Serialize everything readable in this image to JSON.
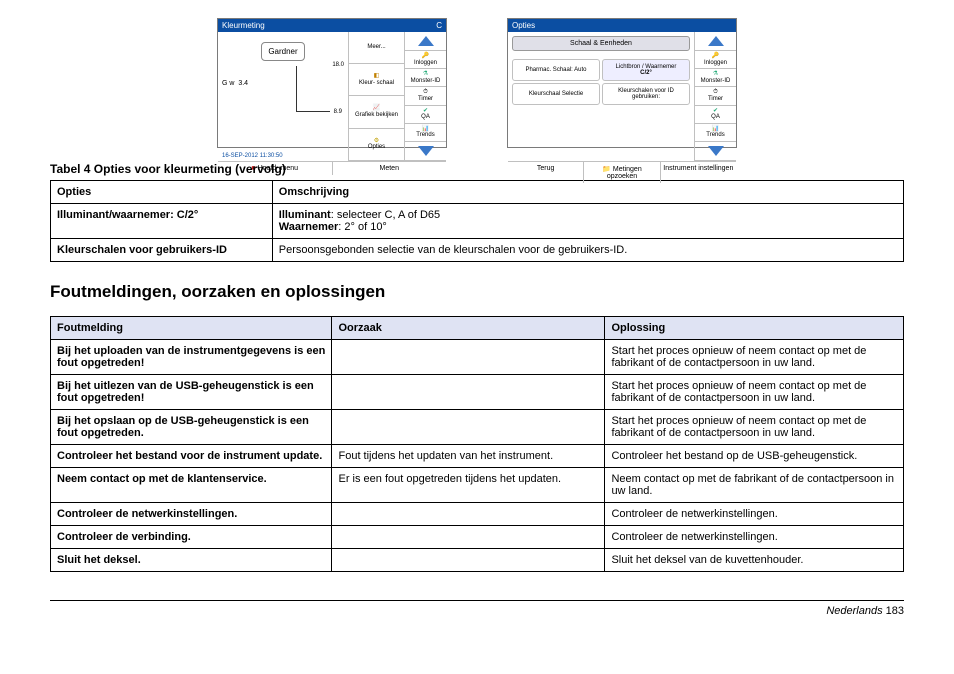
{
  "fig1": {
    "title": "Kleurmeting",
    "menu_more": "Meer...",
    "gardner": "Gardner",
    "gw_label": "G w",
    "gw_value": "3.4",
    "tick_top": "18.0",
    "tick_mid": "8.9",
    "timestamp": "16-SEP-2012  11:30:50",
    "foot_left": "Hoofd-\nmenu",
    "foot_right": "Meten",
    "mid": {
      "b1": "Kleur-\nschaal",
      "b2": "Grafiek\nbekijken",
      "b3": "Opties"
    },
    "side": {
      "s1": "Inloggen",
      "s2": "Monster-ID",
      "s3": "Timer",
      "s4": "QA",
      "s5": "Trends"
    }
  },
  "fig2": {
    "title": "Opties",
    "header": "Schaal & Eenheden",
    "hl_right_t": "Lichtbron / Waarnemer",
    "hl_right_v": "C/2°",
    "c1": "Pharmac. Schaal:\nAuto",
    "c2": "Kleurschalen voor\nID gebruiken:",
    "c3": "Kleurschaal\nSelectie",
    "foot_1": "Terug",
    "foot_2": "Metingen\nopzoeken",
    "foot_3": "Instrument\ninstellingen",
    "side": {
      "s1": "Inloggen",
      "s2": "Monster-ID",
      "s3": "Timer",
      "s4": "QA",
      "s5": "Trends"
    }
  },
  "table4": {
    "caption": "Tabel 4  Opties voor kleurmeting (vervolg)",
    "h1": "Opties",
    "h2": "Omschrijving",
    "r1c1": "Illuminant/waarnemer: C/2°",
    "r1c2a_b": "Illuminant",
    "r1c2a_t": ": selecteer C, A of D65",
    "r1c2b_b": "Waarnemer",
    "r1c2b_t": ": 2° of 10°",
    "r2c1": "Kleurschalen voor gebruikers-ID",
    "r2c2": "Persoonsgebonden selectie van de kleurschalen voor de gebruikers-ID."
  },
  "sec_heading": "Foutmeldingen, oorzaken en oplossingen",
  "err": {
    "h1": "Foutmelding",
    "h2": "Oorzaak",
    "h3": "Oplossing",
    "rows": [
      {
        "c1": "Bij het uploaden van de instrumentgegevens is een fout opgetreden!",
        "c2": "",
        "c3": "Start het proces opnieuw of neem contact op met de fabrikant of de contactpersoon in uw land."
      },
      {
        "c1": "Bij het uitlezen van de USB-geheugenstick is een fout opgetreden!",
        "c2": "",
        "c3": "Start het proces opnieuw of neem contact op met de fabrikant of de contactpersoon in uw land."
      },
      {
        "c1": "Bij het opslaan op de USB-geheugenstick is een fout opgetreden.",
        "c2": "",
        "c3": "Start het proces opnieuw of neem contact op met de fabrikant of de contactpersoon in uw land."
      },
      {
        "c1": "Controleer het bestand voor de instrument update.",
        "c2": "Fout tijdens het updaten van het instrument.",
        "c3": "Controleer het bestand op de USB-geheugenstick."
      },
      {
        "c1": "Neem contact op met de klantenservice.",
        "c2": "Er is een fout opgetreden tijdens het updaten.",
        "c3": "Neem contact op met de fabrikant of de contactpersoon in uw land."
      },
      {
        "c1": "Controleer de netwerkinstellingen.",
        "c2": "",
        "c3": "Controleer de netwerkinstellingen."
      },
      {
        "c1": "Controleer de verbinding.",
        "c2": "",
        "c3": "Controleer de netwerkinstellingen."
      },
      {
        "c1": "Sluit het deksel.",
        "c2": "",
        "c3": "Sluit het deksel van de kuvettenhouder."
      }
    ]
  },
  "footer": {
    "lang": "Nederlands",
    "page": "183"
  }
}
